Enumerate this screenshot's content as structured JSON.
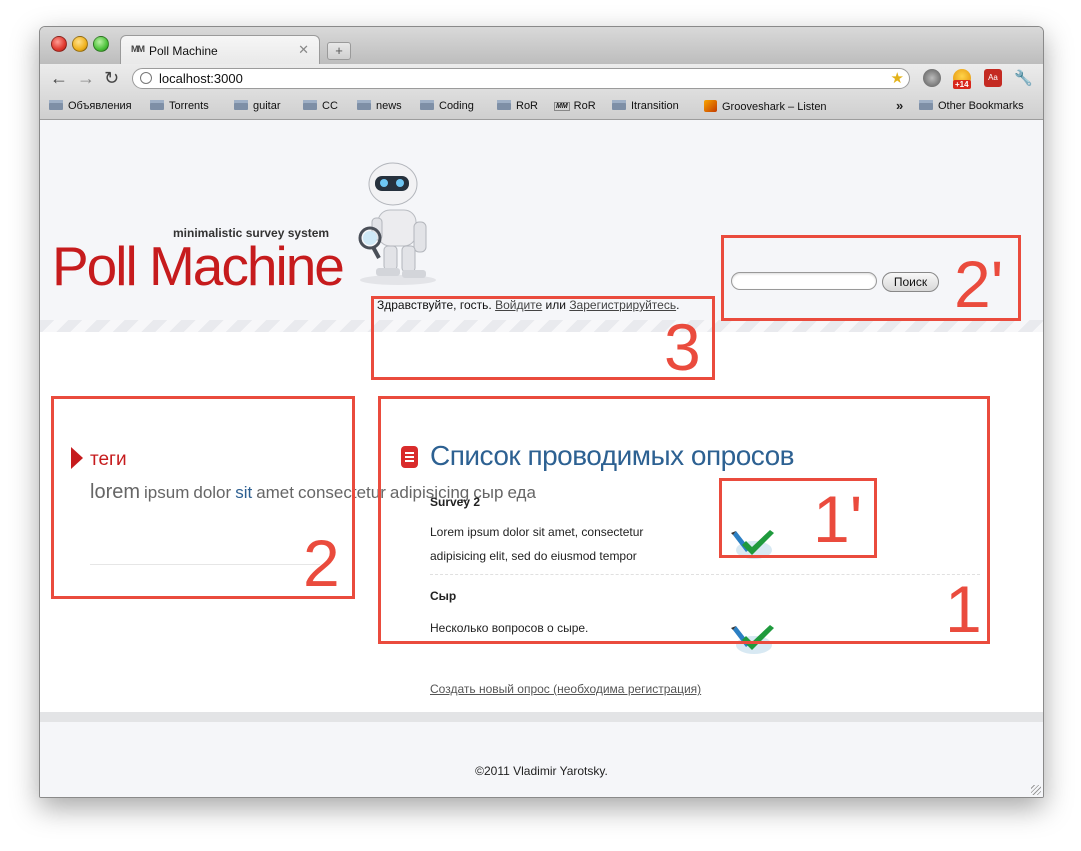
{
  "browser": {
    "tab_title": "Poll Machine",
    "tab_favicon": "MM",
    "new_tab_label": "+",
    "url": "localhost:3000",
    "extension_badge": "+14",
    "extension_label": "Aa",
    "bookmarks": [
      "Объявления",
      "Torrents",
      "guitar",
      "CC",
      "news",
      "Coding",
      "RoR",
      "RoR",
      "Itransition",
      "Grooveshark – Listen"
    ],
    "bookmark_favicon": "MM",
    "bookmarks_overflow": "»",
    "other_bookmarks": "Other Bookmarks"
  },
  "site": {
    "tagline": "minimalistic survey system",
    "logo": "Poll Machine",
    "greeting": {
      "prefix": "Здравствуйте, гость.",
      "login": "Войдите",
      "or": "или",
      "register": "Зарегистрируйтесь",
      "suffix": "."
    },
    "search": {
      "placeholder": "",
      "button": "Поиск"
    },
    "tags": {
      "title": "теги",
      "items": [
        "lorem",
        "ipsum",
        "dolor",
        "sit",
        "amet",
        "consectetur",
        "adipisicing",
        "сыр",
        "еда"
      ]
    },
    "polls": {
      "title": "Список проводимых опросов",
      "items": [
        {
          "title": "Survey 2",
          "description": "Lorem ipsum dolor sit amet, consectetur adipisicing elit, sed do eiusmod tempor"
        },
        {
          "title": "Сыр",
          "description": "Несколько вопросов о сыре."
        }
      ],
      "create_link": "Создать новый опрос (необходима регистрация)"
    },
    "footer": "©2011 Vladimir Yarotsky."
  },
  "annotations": [
    "1",
    "1'",
    "2",
    "2'",
    "3"
  ],
  "icons": [
    "back-icon",
    "forward-icon",
    "reload-icon",
    "globe-icon",
    "star-icon",
    "wrench-icon",
    "folder-icon",
    "robot-icon",
    "vote-checkmark-icon",
    "list-icon",
    "arrow-icon"
  ],
  "colors": {
    "logo_red": "#c61b1d",
    "title_blue": "#2d6192",
    "annotation_red": "#ea4b3d"
  }
}
